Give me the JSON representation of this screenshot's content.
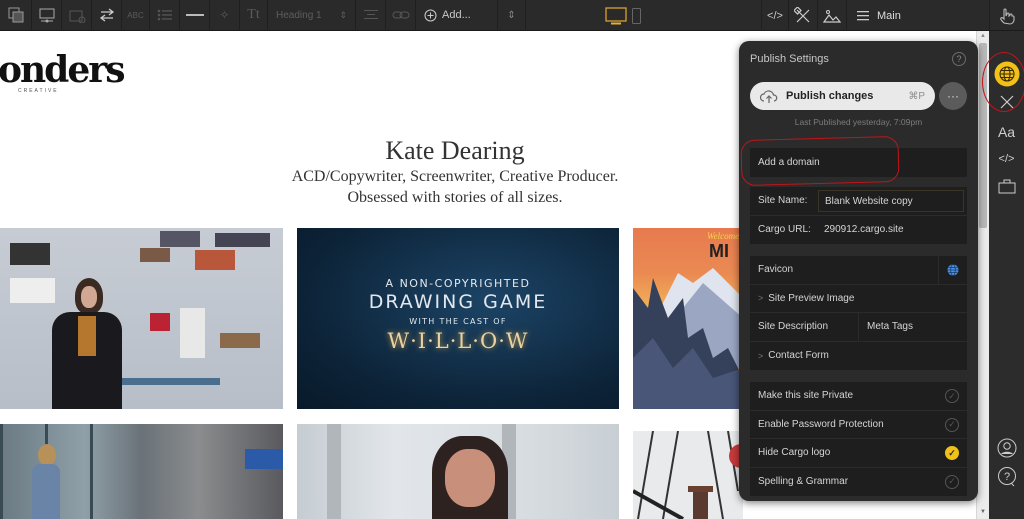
{
  "toolbar": {
    "heading_select": "Heading 1",
    "add_label": "Add...",
    "menu_label": "Main",
    "active_device": "desktop",
    "accent": "#e0a82e"
  },
  "site": {
    "logo": "onders",
    "logo_sub": "CREATIVE",
    "name": "Kate Dearing",
    "tagline_1": "ACD/Copywriter, Screenwriter, Creative Producer.",
    "tagline_2": "Obsessed with stories of all sizes.",
    "thumbnails": [
      {
        "title_lines": [],
        "caption": "woman-in-front-of-web-wall"
      },
      {
        "title_lines": [
          "A NON-COPYRIGHTED",
          "DRAWING GAME",
          "WITH THE CAST OF",
          "W·I·L·L·O·W"
        ]
      },
      {
        "title_lines": [
          "Welcome",
          "MI"
        ]
      },
      {
        "title_lines": []
      },
      {
        "title_lines": []
      },
      {
        "title_lines": []
      }
    ]
  },
  "publish_panel": {
    "title": "Publish Settings",
    "help": "?",
    "publish_button": "Publish changes",
    "publish_shortcut": "⌘P",
    "more": "···",
    "last_published": "Last Published yesterday, 7:09pm",
    "add_domain": "Add a domain",
    "site_name_label": "Site Name:",
    "site_name_value": "Blank Website copy",
    "cargo_url_label": "Cargo URL:",
    "cargo_url_value": "290912.cargo.site",
    "favicon": "Favicon",
    "site_preview_image": "Site Preview Image",
    "site_description": "Site Description",
    "meta_tags": "Meta Tags",
    "contact_form": "Contact Form",
    "toggles": [
      {
        "label": "Make this site Private",
        "checked": false
      },
      {
        "label": "Enable Password Protection",
        "checked": false
      },
      {
        "label": "Hide Cargo logo",
        "checked": true
      },
      {
        "label": "Spelling & Grammar",
        "checked": false
      }
    ]
  },
  "sidebar": {
    "items": [
      "globe",
      "design-tools",
      "typography",
      "code",
      "commerce",
      "account",
      "help"
    ],
    "typography_label": "Aa",
    "code_label": "</>",
    "active": "globe",
    "active_color": "#f2c118"
  }
}
